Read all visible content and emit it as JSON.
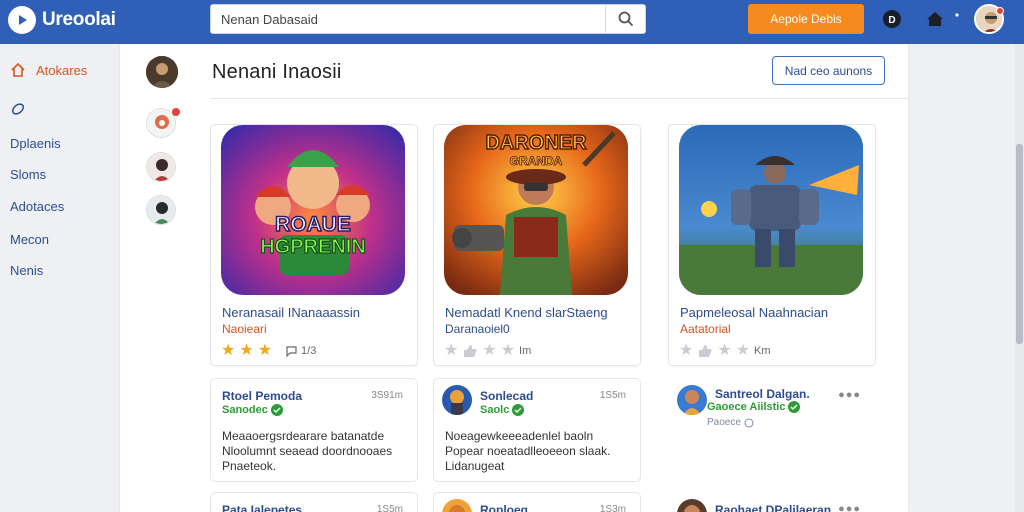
{
  "brand": {
    "name": "Ureoolai"
  },
  "search": {
    "value": "Nenan Dabasaid",
    "placeholder": ""
  },
  "header_cta": {
    "label": "Aepole Debis"
  },
  "sidebar": {
    "items": [
      {
        "label": "Atokares"
      },
      {
        "label": ""
      },
      {
        "label": "Dplaenis"
      },
      {
        "label": "Sloms"
      },
      {
        "label": "Adotaces"
      },
      {
        "label": "Mecon"
      },
      {
        "label": "Nenis"
      }
    ]
  },
  "main": {
    "title": "Nenani Inaosii",
    "action_button": "Nad ceo aunons"
  },
  "games": [
    {
      "art_text": "ROAUE HGPRENIN",
      "title": "Neranasail INanaaassin",
      "subtitle": "Naoieari",
      "rating": 3,
      "rating_text": "1/3"
    },
    {
      "art_text": "DARONER GRANDA",
      "title": "Nemadatl Knend slarStaeng",
      "subtitle": "Daranaoiel0",
      "rating": 0,
      "rating_text": "Im"
    },
    {
      "art_text": "",
      "title": "Papmeleosal Naahnacian",
      "subtitle": "Aatatorial",
      "rating": 0,
      "rating_text": "Km"
    }
  ],
  "reviews": [
    {
      "name": "Rtoel Pemoda",
      "time": "3S91m",
      "status": "Sanodec",
      "body": "Meaaoergsrdearare batanatde Nloolumnt seaead doordnooaes Pnaeteok."
    },
    {
      "name": "Sonlecad",
      "time": "1S5m",
      "status": "Saolc",
      "body": "Noeagewkeeeadenlel baoln Popear noeatadlleoeeon slaak. Lidanugeat"
    },
    {
      "name": "Santreol Dalgan.",
      "time": "",
      "status": "Gaoece Aiilstic",
      "sub": "Paoece",
      "body": ""
    }
  ],
  "reviews_row2": [
    {
      "name": "Pata Ialepetes",
      "time": "1S5m"
    },
    {
      "name": "Roploeg",
      "time": "1S3m"
    },
    {
      "name": "Raohaet DPalilaeran",
      "time": ""
    }
  ],
  "colors": {
    "topbar": "#2f5fb6",
    "accent_orange": "#f58a1f",
    "link_blue": "#2d4c8e",
    "status_green": "#2e9b36",
    "star": "#f2a81d"
  }
}
